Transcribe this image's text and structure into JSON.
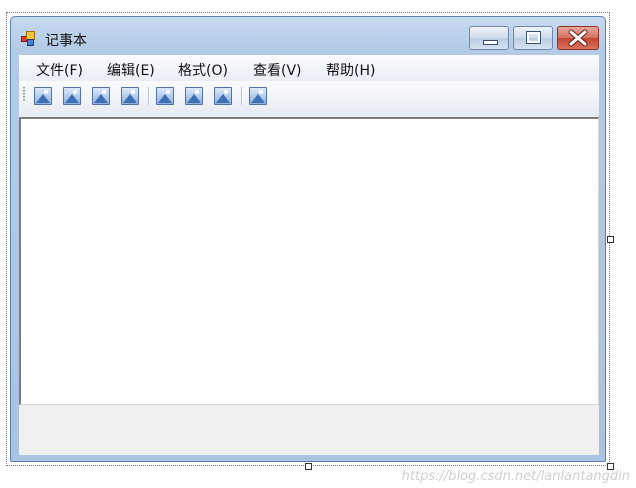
{
  "window": {
    "title": "记事本"
  },
  "menu": {
    "items": [
      {
        "label": "文件(F)"
      },
      {
        "label": "编辑(E)"
      },
      {
        "label": "格式(O)"
      },
      {
        "label": "查看(V)"
      },
      {
        "label": "帮助(H)"
      }
    ]
  },
  "toolbar": {
    "icon": "picture-icon",
    "button_count": 8
  },
  "colors": {
    "title_gradient": "#b4cbe7",
    "close_button": "#c44531",
    "editor_background": "#ffffff"
  },
  "watermark": "https://blog.csdn.net/lanlantangdin"
}
